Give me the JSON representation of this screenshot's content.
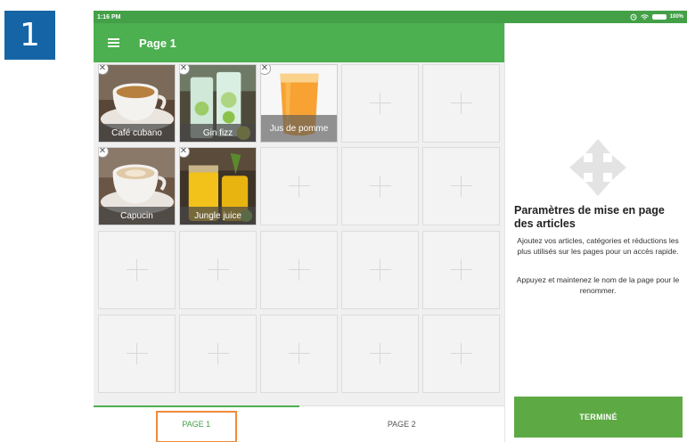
{
  "step_badge": "1",
  "status_bar": {
    "time": "1:16 PM",
    "battery_text": "100%",
    "icons": [
      "alarm-icon",
      "wifi-icon",
      "battery-icon"
    ]
  },
  "app_bar": {
    "title": "Page 1",
    "menu_icon": "hamburger-menu-icon"
  },
  "grid": {
    "items": [
      {
        "label": "Café cubano",
        "image": "coffee-cup"
      },
      {
        "label": "Gin fizz",
        "image": "gin-glasses"
      },
      {
        "label": "Jus de pomme",
        "image": "apple-juice-glass"
      },
      {
        "label": "Capucin",
        "image": "cappuccino-cup"
      },
      {
        "label": "Jungle juice",
        "image": "juice-jars"
      }
    ],
    "remove_symbol": "✕",
    "empty_slot_icon": "plus-icon"
  },
  "tabs": [
    {
      "label": "PAGE 1",
      "active": true
    },
    {
      "label": "PAGE 2",
      "active": false
    }
  ],
  "side_panel": {
    "icon": "move-arrows-icon",
    "title": "Paramètres de mise en page des articles",
    "paragraph1": "Ajoutez vos articles, catégories et réductions les plus utilisés sur les pages pour un accès rapide.",
    "paragraph2": "Appuyez et maintenez le nom de la page pour le renommer.",
    "done_button": "TERMINÉ"
  },
  "colors": {
    "primary_green": "#4caf50",
    "status_green": "#43a047",
    "button_green": "#5daa45",
    "badge_blue": "#1565a6",
    "highlight_orange": "#ef8a3a"
  }
}
